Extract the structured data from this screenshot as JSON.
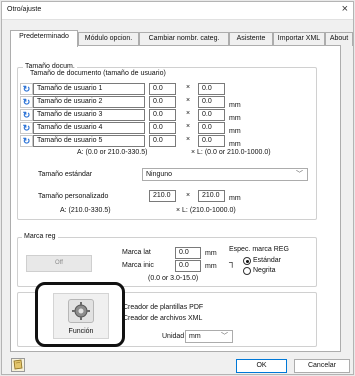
{
  "window": {
    "title": "Otro/ajuste",
    "close_glyph": "×"
  },
  "tabs": [
    {
      "label": "Predeterminado",
      "active": true
    },
    {
      "label": "Módulo opcion.",
      "active": false
    },
    {
      "label": "Cambiar nombr. categ.",
      "active": false
    },
    {
      "label": "Asistente",
      "active": false
    },
    {
      "label": "Importar XML",
      "active": false
    },
    {
      "label": "About",
      "active": false
    }
  ],
  "paper_size": {
    "group_title": "Tamaño docum.",
    "subtitle": "Tamaño de documento (tamaño de usuario)",
    "rows": [
      {
        "name": "Tamaño de usuario 1",
        "w": "0.0",
        "h": "0.0"
      },
      {
        "name": "Tamaño de usuario 2",
        "w": "0.0",
        "h": "0.0"
      },
      {
        "name": "Tamaño de usuario 3",
        "w": "0.0",
        "h": "0.0"
      },
      {
        "name": "Tamaño de usuario 4",
        "w": "0.0",
        "h": "0.0"
      },
      {
        "name": "Tamaño de usuario 5",
        "w": "0.0",
        "h": "0.0"
      }
    ],
    "times": "×",
    "unit": "mm",
    "range_a": "A:    (0.0 or 210.0-330.5)",
    "range_l": "×  L:     (0.0 or 210.0-1000.0)",
    "standard_label": "Tamaño estándar",
    "standard_value": "Ninguno",
    "custom_label": "Tamaño personalizado",
    "custom_w": "210.0",
    "custom_h": "210.0",
    "custom_range_a": "A:     (210.0-330.5)",
    "custom_range_l": "×   L:          (210.0-1000.0)"
  },
  "register_mark": {
    "group_title": "Marca reg",
    "toggle_label": "Off",
    "lat_label": "Marca lat",
    "lat_value": "0.0",
    "init_label": "Marca inic",
    "init_value": "0.0",
    "unit": "mm",
    "range": "(0.0 or 3.0-15.0)",
    "spec_title": "Espec. marca REG",
    "options": [
      {
        "label": "Estándar",
        "selected": true
      },
      {
        "label": "Negrita",
        "selected": false
      }
    ]
  },
  "function_group": {
    "create_pdf_label": "Creador de plantillas PDF",
    "create_xml_label": "Creador de archivos XML",
    "unit_label": "Unidad",
    "unit_value": "mm",
    "function_button_label": "Función",
    "function_icon": "gear-tools-icon"
  },
  "footer": {
    "ok_label": "OK",
    "cancel_label": "Cancelar",
    "help_icon": "book-icon"
  }
}
